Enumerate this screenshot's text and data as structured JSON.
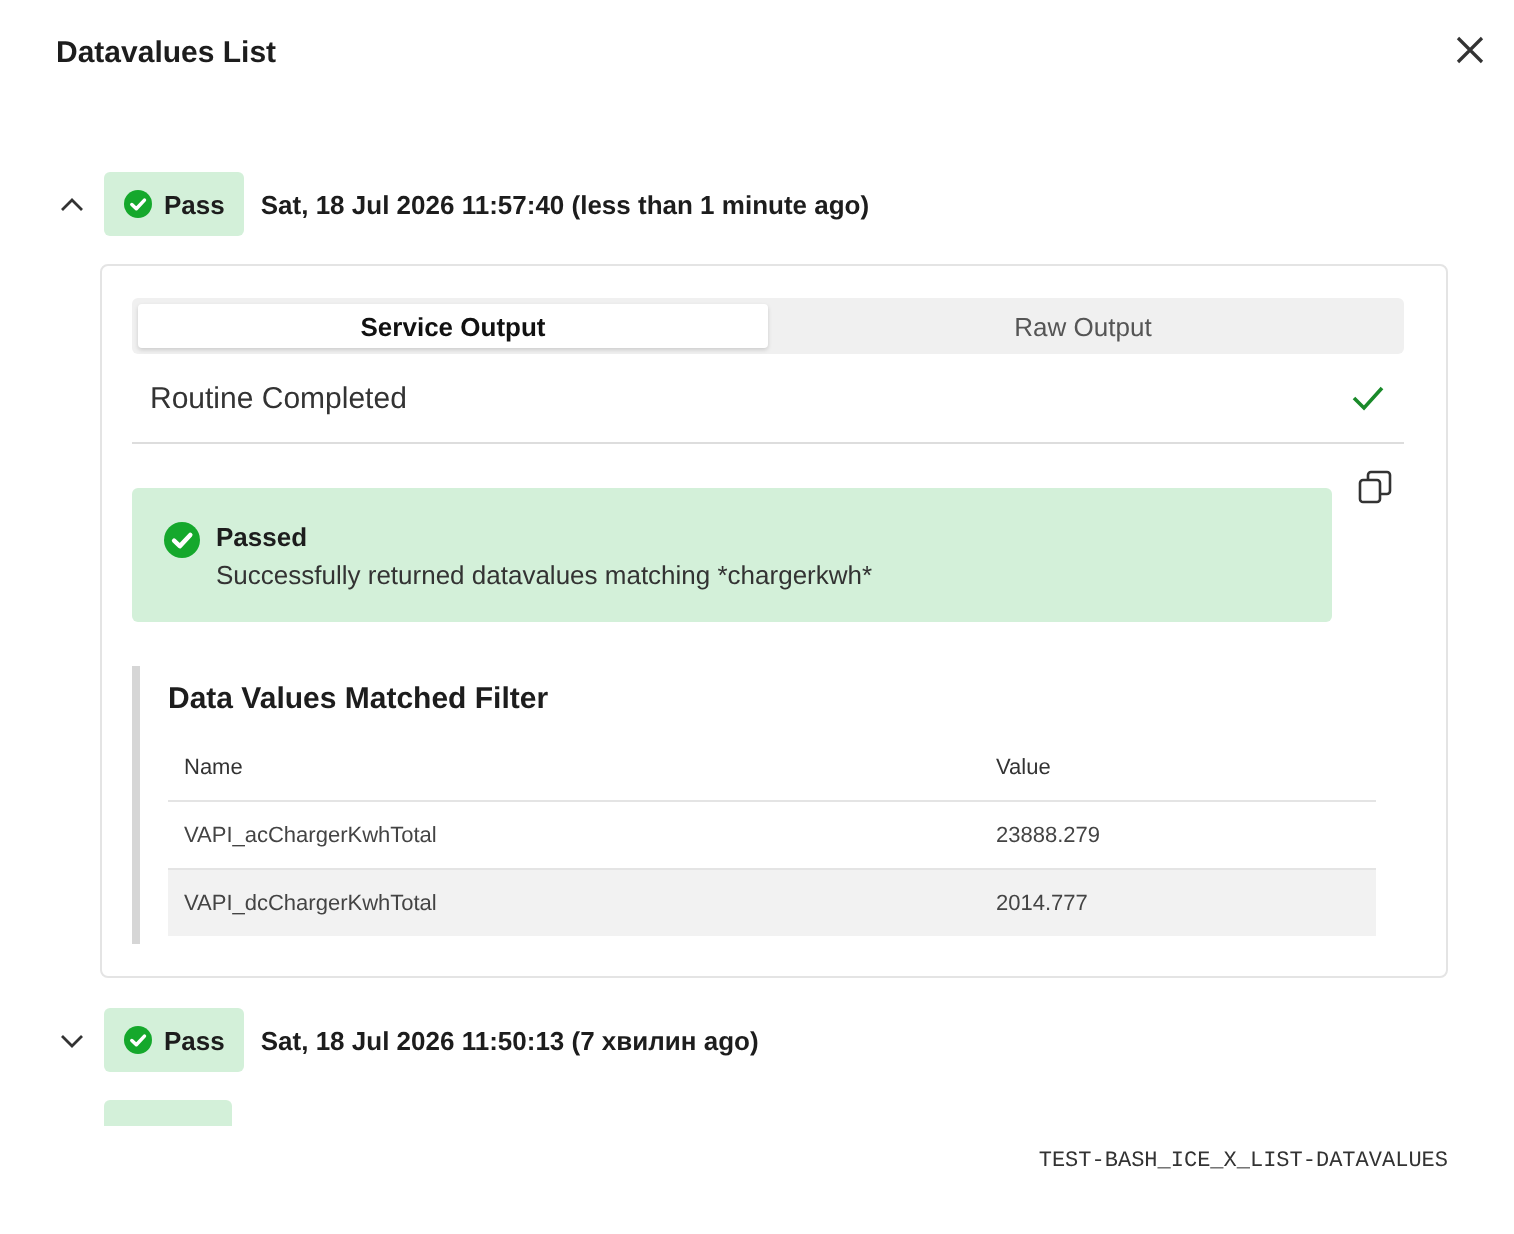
{
  "dialog": {
    "title": "Datavalues List"
  },
  "runs": [
    {
      "passed": true,
      "badge": "Pass",
      "time": "Sat, 18 Jul 2026 11:57:40 (less than 1 minute ago)",
      "expanded": true,
      "details": {
        "tabs": [
          {
            "label": "Service Output",
            "selected": true
          },
          {
            "label": "Raw Output",
            "selected": false
          }
        ],
        "routine": {
          "label": "Routine Completed",
          "done": true
        },
        "alert": {
          "passed": true,
          "title": "Passed",
          "message": "Successfully returned datavalues matching *chargerkwh*"
        },
        "table": {
          "title": "Data Values Matched Filter",
          "columns": [
            "Name",
            "Value"
          ],
          "rows": [
            [
              "VAPI_acChargerKwhTotal",
              "23888.279"
            ],
            [
              "VAPI_dcChargerKwhTotal",
              "2014.777"
            ]
          ]
        }
      }
    },
    {
      "passed": true,
      "badge": "Pass",
      "time": "Sat, 18 Jul 2026 11:50:13 (7 хвилин ago)",
      "expanded": false
    },
    {
      "passed": true
    }
  ],
  "footer": {
    "test_id": "TEST-BASH_ICE_X_LIST-DATAVALUES"
  }
}
